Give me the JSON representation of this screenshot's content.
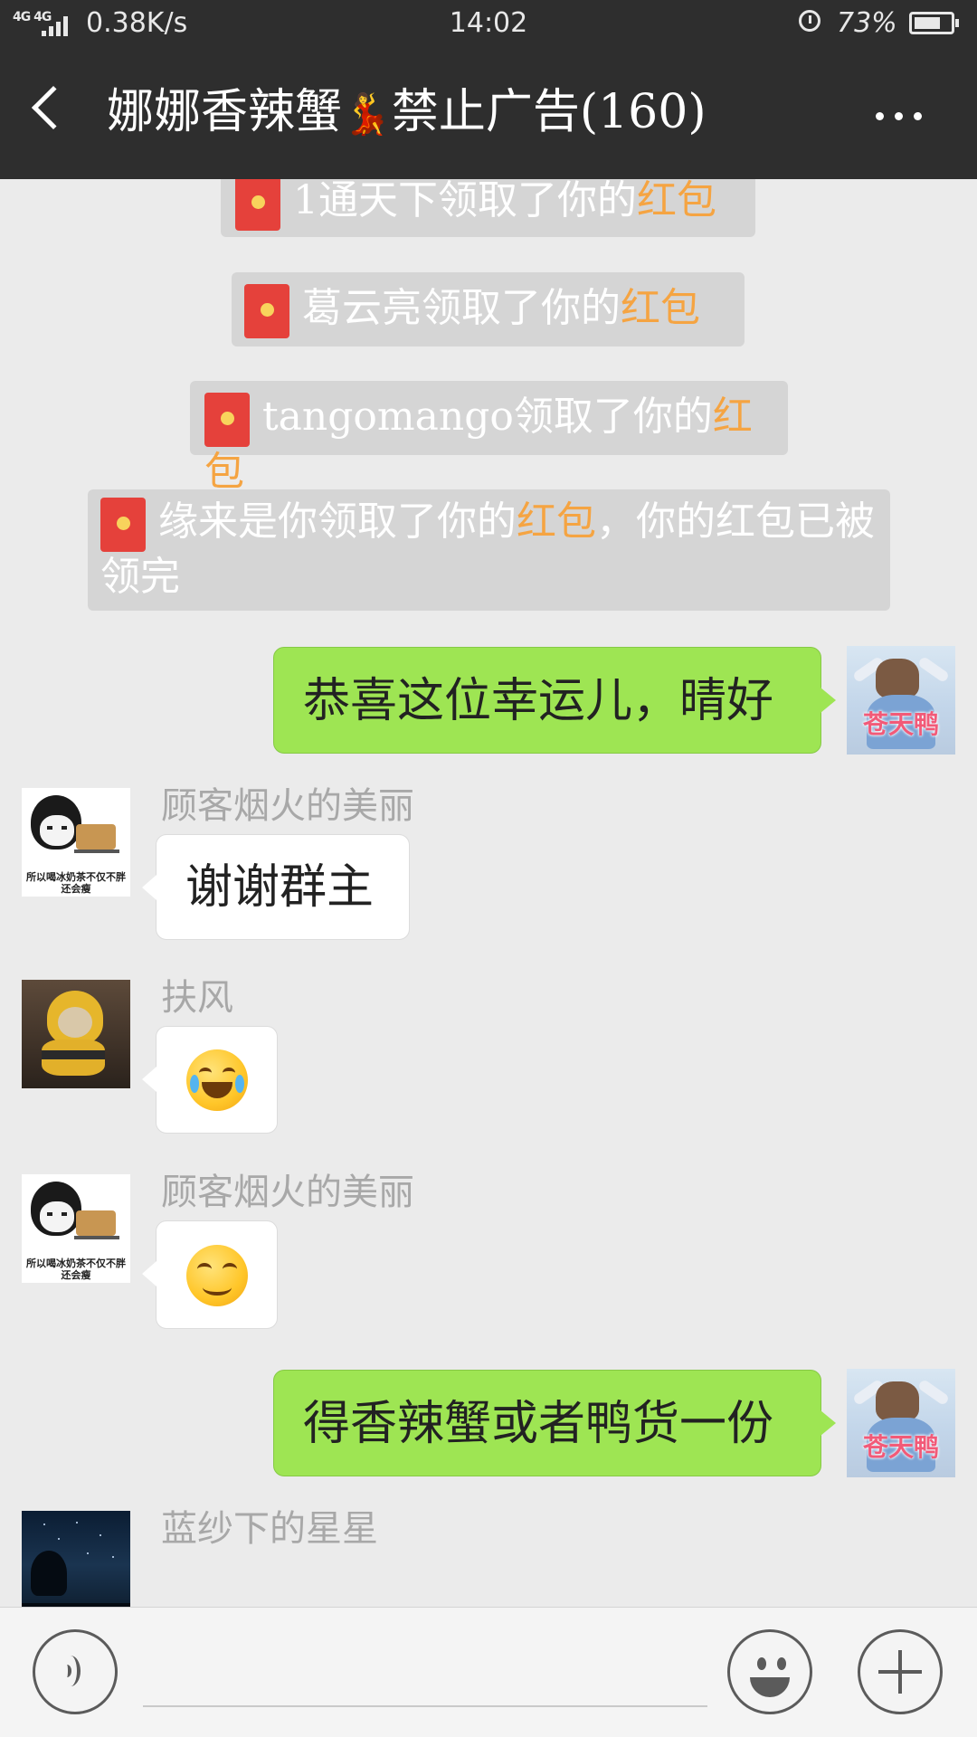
{
  "status_bar": {
    "network": "4G 4G",
    "speed": "0.38K/s",
    "time": "14:02",
    "battery": "73%",
    "battery_level": 0.73
  },
  "header": {
    "title": "娜娜香辣蟹",
    "title_emoji": "💃",
    "title_suffix": "禁止广告(160)"
  },
  "messages": {
    "system": [
      {
        "prefix": "1通天下领取了你的",
        "highlight": "红包",
        "suffix": ""
      },
      {
        "prefix": "葛云亮领取了你的",
        "highlight": "红包",
        "suffix": ""
      },
      {
        "prefix": "tangomango领取了你的",
        "highlight": "红包",
        "suffix": ""
      },
      {
        "prefix": "缘来是你领取了你的",
        "highlight": "红包",
        "suffix": "，你的红包已被领完"
      }
    ],
    "out_1": {
      "text": "恭喜这位幸运儿，晴好",
      "avatar_label": "苍天鸭"
    },
    "in_1": {
      "sender": "顾客烟火的美丽",
      "text": "谢谢群主",
      "avatar_caption": "所以喝冰奶茶不仅不胖还会瘦"
    },
    "in_2": {
      "sender": "扶风",
      "emoji": "joy-emoji"
    },
    "in_3": {
      "sender": "顾客烟火的美丽",
      "emoji": "smirk-emoji",
      "avatar_caption": "所以喝冰奶茶不仅不胖还会瘦"
    },
    "out_2": {
      "text": "得香辣蟹或者鸭货一份",
      "avatar_label": "苍天鸭"
    },
    "in_4": {
      "sender": "蓝纱下的星星"
    }
  },
  "input_bar": {
    "text_value": "",
    "icons": [
      "voice-icon",
      "emoji-icon",
      "plus-icon"
    ]
  },
  "colors": {
    "header_bg": "#2e2e2e",
    "chat_bg": "#ebebeb",
    "out_bubble": "#9ee553",
    "in_bubble": "#ffffff",
    "hongbao_highlight": "#f5a442",
    "envelope_red": "#e5413b"
  }
}
